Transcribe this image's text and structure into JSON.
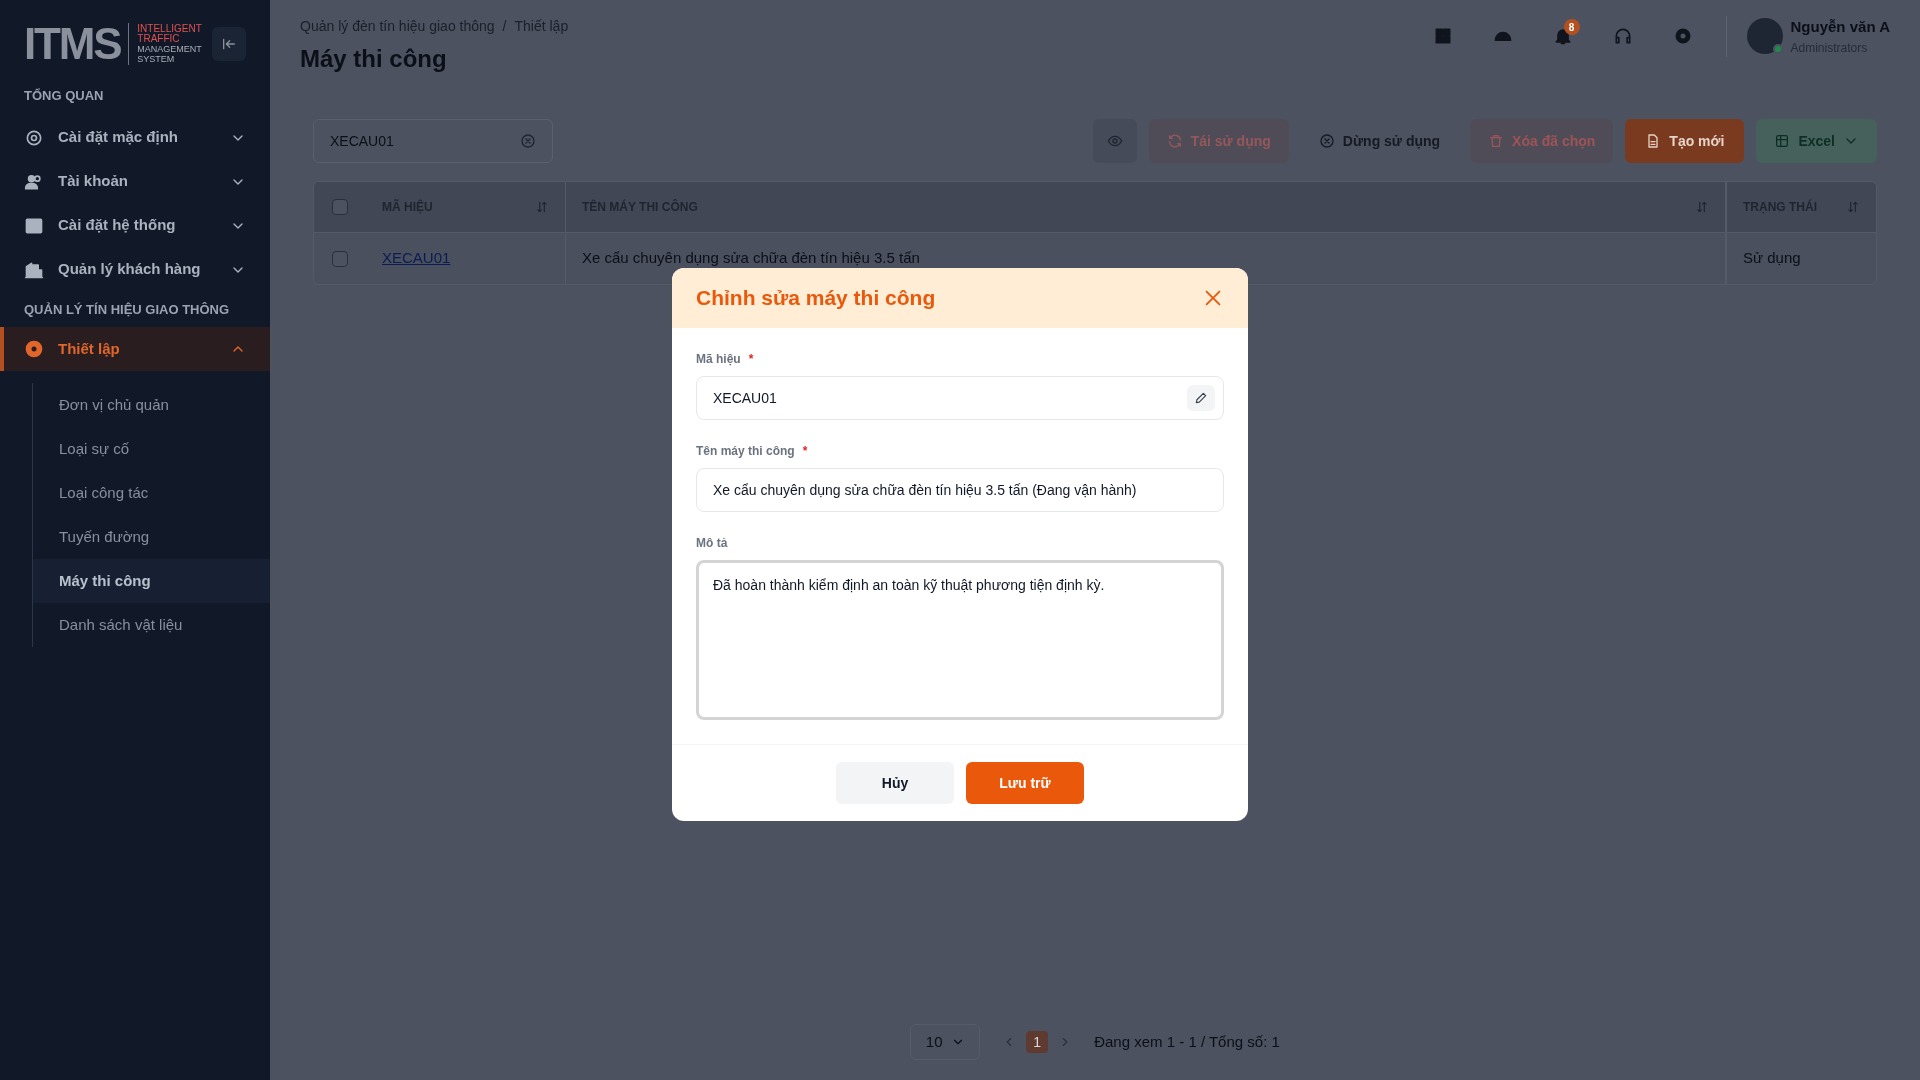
{
  "sidebar": {
    "logo": {
      "mark": "ITMS",
      "tagline": [
        "INTELLIGENT",
        "TRAFFIC",
        "MANAGEMENT",
        "SYSTEM"
      ]
    },
    "sections": [
      {
        "title": "TỔNG QUAN",
        "items": [
          {
            "label": "Cài đặt mặc định",
            "expanded": false,
            "selected": false
          },
          {
            "label": "Tài khoản",
            "expanded": false,
            "selected": false
          },
          {
            "label": "Cài đặt hệ thống",
            "expanded": false,
            "selected": false
          },
          {
            "label": "Quản lý khách hàng",
            "expanded": false,
            "selected": false
          }
        ]
      },
      {
        "title": "QUẢN LÝ TÍN HIỆU GIAO THÔNG",
        "items": [
          {
            "label": "Thiết lập",
            "expanded": true,
            "selected": true,
            "children": [
              {
                "label": "Đơn vị chủ quản",
                "selected": false
              },
              {
                "label": "Loại sự cố",
                "selected": false
              },
              {
                "label": "Loại công tác",
                "selected": false
              },
              {
                "label": "Tuyến đường",
                "selected": false
              },
              {
                "label": "Máy thi công",
                "selected": true
              },
              {
                "label": "Danh sách vật liệu",
                "selected": false
              }
            ]
          }
        ]
      }
    ]
  },
  "header": {
    "breadcrumb": [
      "Quản lý đèn tín hiệu giao thông",
      "Thiết lập"
    ],
    "breadcrumb_separator": "/",
    "title": "Máy thi công",
    "notification_count": "8",
    "user": {
      "name": "Nguyễn văn A",
      "role": "Administrators"
    }
  },
  "toolbar": {
    "search": {
      "value": "XECAU01"
    },
    "buttons": [
      {
        "kind": "view"
      },
      {
        "kind": "reuse",
        "label": "Tái sử dụng",
        "disabled": true
      },
      {
        "kind": "stop",
        "label": "Dừng sử dụng",
        "disabled": false
      },
      {
        "kind": "delete",
        "label": "Xóa đã chọn",
        "disabled": true
      },
      {
        "kind": "create",
        "label": "Tạo mới",
        "disabled": false
      },
      {
        "kind": "excel",
        "label": "Excel",
        "disabled": false
      }
    ]
  },
  "table": {
    "all_selected": false,
    "columns": [
      {
        "label": "MÃ HIỆU",
        "sortable": true
      },
      {
        "label": "TÊN MÁY THI CÔNG",
        "sortable": true
      },
      {
        "label": "TRẠNG THÁI",
        "sortable": true
      }
    ],
    "rows": [
      {
        "checked": false,
        "code": "XECAU01",
        "name": "Xe cẩu chuyên dụng sửa chữa đèn tín hiệu 3.5 tấn",
        "status": "Sử dụng"
      }
    ]
  },
  "pagination": {
    "page_size": "10",
    "pages": [
      {
        "label": "1",
        "selected": true
      }
    ],
    "summary": "Đang xem 1 - 1 / Tổng số: 1"
  },
  "modal": {
    "title": "Chỉnh sửa máy thi công",
    "required_mark": "*",
    "fields": [
      {
        "kind": "input",
        "label": "Mã hiệu",
        "required": true,
        "value": "XECAU01",
        "editable_icon": true
      },
      {
        "kind": "input",
        "label": "Tên máy thi công",
        "required": true,
        "value": "Xe cẩu chuyên dụng sửa chữa đèn tín hiệu 3.5 tấn (Đang vận hành)",
        "editable_icon": false
      },
      {
        "kind": "textarea",
        "label": "Mô tả",
        "required": false,
        "value": "Đã hoàn thành kiểm định an toàn kỹ thuật phương tiện định kỳ."
      }
    ],
    "buttons": [
      {
        "kind": "cancel",
        "label": "Hủy"
      },
      {
        "kind": "save",
        "label": "Lưu trữ"
      }
    ]
  }
}
